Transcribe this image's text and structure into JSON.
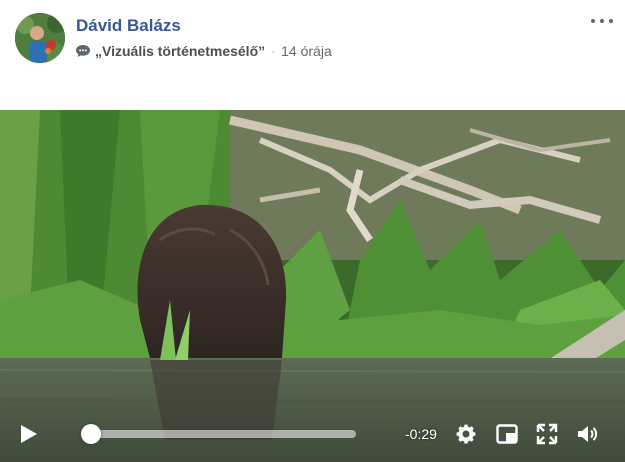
{
  "post": {
    "author": "Dávid Balázs",
    "activity": "„Vizuális történetmesélő”",
    "separator": "·",
    "timestamp": "14 órája",
    "more_icon": "more-horizontal-icon",
    "activity_icon": "speech-bubble-icon"
  },
  "video": {
    "time_remaining": "-0:29",
    "progress": 0,
    "controls": [
      "play-icon",
      "settings-gear-icon",
      "picture-in-picture-icon",
      "fullscreen-icon",
      "volume-icon"
    ]
  },
  "colors": {
    "author_link": "#385898",
    "meta_text": "#616770",
    "controls": "#ffffff"
  }
}
